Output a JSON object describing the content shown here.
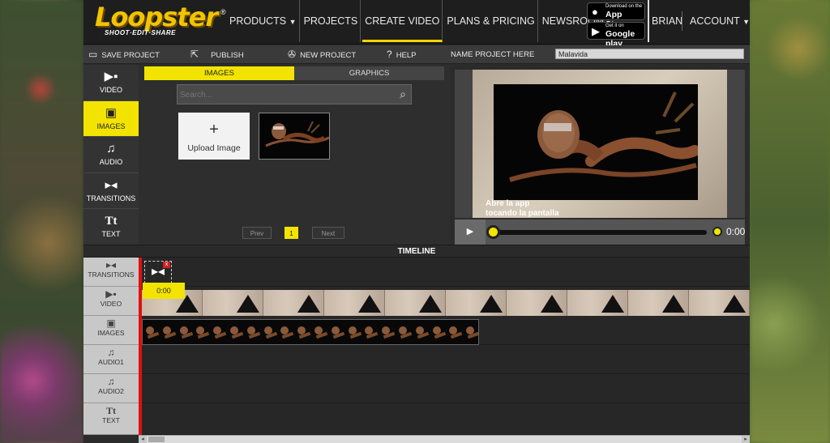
{
  "brand": {
    "name": "Loopster",
    "tagline": "SHOOT·EDIT·SHARE",
    "registered": "®"
  },
  "nav": {
    "items": [
      {
        "label": "PRODUCTS",
        "dropdown": true
      },
      {
        "label": "PROJECTS"
      },
      {
        "label": "CREATE VIDEO",
        "active": true
      },
      {
        "label": "PLANS & PRICING"
      },
      {
        "label": "NEWSROOM"
      }
    ],
    "app_store": {
      "line1": "Download on the",
      "line2": "App Store"
    },
    "google_play": {
      "line1": "Get it on",
      "line2": "Google play"
    },
    "user": "BRIAN",
    "account": "ACCOUNT"
  },
  "toolbar": {
    "save": "SAVE PROJECT",
    "publish": "PUBLISH",
    "new_project": "NEW PROJECT",
    "help": "HELP",
    "name_label": "NAME PROJECT HERE",
    "project_name": "Malavida"
  },
  "sidebar": {
    "items": [
      {
        "label": "VIDEO",
        "icon": "video-camera-icon"
      },
      {
        "label": "IMAGES",
        "icon": "image-icon",
        "active": true
      },
      {
        "label": "AUDIO",
        "icon": "music-note-icon"
      },
      {
        "label": "TRANSITIONS",
        "icon": "bowtie-icon"
      },
      {
        "label": "TEXT",
        "icon": "text-icon"
      }
    ]
  },
  "media": {
    "tabs": [
      "IMAGES",
      "GRAPHICS"
    ],
    "active_tab": "IMAGES",
    "search_placeholder": "Search...",
    "upload_label": "Upload Image",
    "pager": {
      "prev": "Prev",
      "page": "1",
      "next": "Next"
    }
  },
  "preview": {
    "caption_line1": "Abre la app",
    "caption_line2": "tocando la pantalla",
    "time": "0:00"
  },
  "timeline": {
    "title": "TIMELINE",
    "tracks": [
      {
        "label": "TRANSITIONS",
        "icon": "bowtie-icon"
      },
      {
        "label": "VIDEO",
        "icon": "video-camera-icon"
      },
      {
        "label": "IMAGES",
        "icon": "image-icon"
      },
      {
        "label": "AUDIO1",
        "icon": "music-note-icon"
      },
      {
        "label": "AUDIO2",
        "icon": "music-note-icon"
      },
      {
        "label": "TEXT",
        "icon": "text-icon"
      }
    ],
    "time_tag": "0:00"
  },
  "colors": {
    "accent": "#f2e400",
    "playhead": "#e01010",
    "background": "#2b2b2b"
  }
}
